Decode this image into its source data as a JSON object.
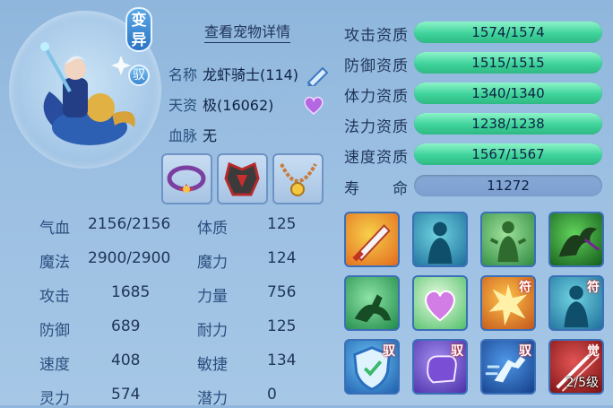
{
  "header": {
    "mutant_badge": "变异",
    "ride_badge": "驭",
    "detail_link": "查看宠物详情"
  },
  "info": {
    "name_label": "名称",
    "name_value": "龙虾骑士(114)",
    "talent_label": "天资",
    "talent_value": "极(16062)",
    "bloodline_label": "血脉",
    "bloodline_value": "无"
  },
  "stats": [
    {
      "label": "气血",
      "value": "2156/2156",
      "label2": "体质",
      "value2": "125"
    },
    {
      "label": "魔法",
      "value": "2900/2900",
      "label2": "魔力",
      "value2": "124"
    },
    {
      "label": "攻击",
      "value": "1685",
      "label2": "力量",
      "value2": "756"
    },
    {
      "label": "防御",
      "value": "689",
      "label2": "耐力",
      "value2": "125"
    },
    {
      "label": "速度",
      "value": "408",
      "label2": "敏捷",
      "value2": "134"
    },
    {
      "label": "灵力",
      "value": "574",
      "label2": "潜力",
      "value2": "0"
    }
  ],
  "aptitudes": [
    {
      "label": "攻击资质",
      "value": "1574/1574",
      "fill": 1.0
    },
    {
      "label": "防御资质",
      "value": "1515/1515",
      "fill": 1.0
    },
    {
      "label": "体力资质",
      "value": "1340/1340",
      "fill": 1.0
    },
    {
      "label": "法力资质",
      "value": "1238/1238",
      "fill": 1.0
    },
    {
      "label": "速度资质",
      "value": "1567/1567",
      "fill": 1.0
    }
  ],
  "lifespan": {
    "label": "寿　　命",
    "value": "11272"
  },
  "skills": [
    {
      "icon": "sword-icon",
      "tag": "",
      "level": ""
    },
    {
      "icon": "spirit-figure-icon",
      "tag": "",
      "level": ""
    },
    {
      "icon": "green-figure-icon",
      "tag": "",
      "level": ""
    },
    {
      "icon": "shadow-claw-icon",
      "tag": "",
      "level": ""
    },
    {
      "icon": "running-beast-icon",
      "tag": "",
      "level": ""
    },
    {
      "icon": "heart-icon",
      "tag": "",
      "level": ""
    },
    {
      "icon": "explosion-icon",
      "tag": "符",
      "level": ""
    },
    {
      "icon": "spirit-figure-icon",
      "tag": "符",
      "level": ""
    },
    {
      "icon": "shield-icon",
      "tag": "驭",
      "level": ""
    },
    {
      "icon": "fist-icon",
      "tag": "驭",
      "level": ""
    },
    {
      "icon": "dash-icon",
      "tag": "驭",
      "level": ""
    },
    {
      "icon": "slash-icon",
      "tag": "觉",
      "level": "2/5级"
    }
  ],
  "colors": {
    "bar_fill": "#3fd39b",
    "panel_bg": "#9bbfe2",
    "accent": "#2d74c4"
  }
}
